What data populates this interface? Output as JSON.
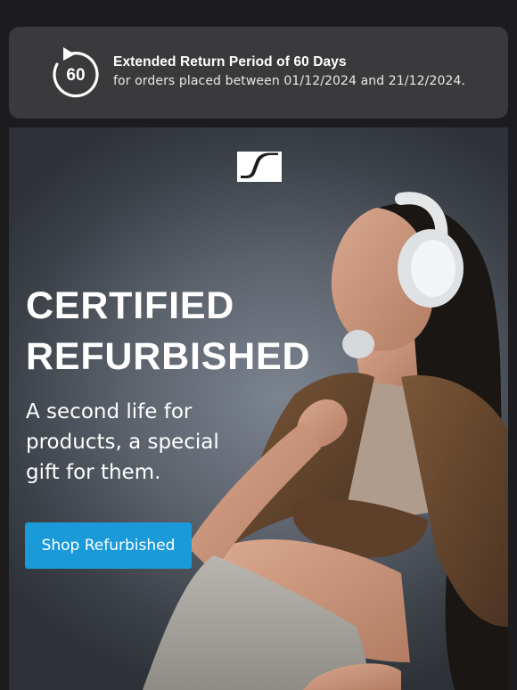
{
  "notice": {
    "icon": "return-60-days-icon",
    "badge_number": "60",
    "title": "Extended Return Period of 60 Days",
    "subtitle": "for orders placed between 01/12/2024 and 21/12/2024."
  },
  "hero": {
    "logo": "sennheiser-logo",
    "headline_line1": "CERTIFIED",
    "headline_line2": "REFURBISHED",
    "subheadline": "A second life for products, a special gift for them.",
    "cta_label": "Shop Refurbished",
    "cta_color": "#1a9ad9",
    "image": "woman-wearing-white-headphones-photo"
  },
  "colors": {
    "page_background": "#1c1c1e",
    "notice_background": "#3a3a3c",
    "text": "#ffffff"
  }
}
